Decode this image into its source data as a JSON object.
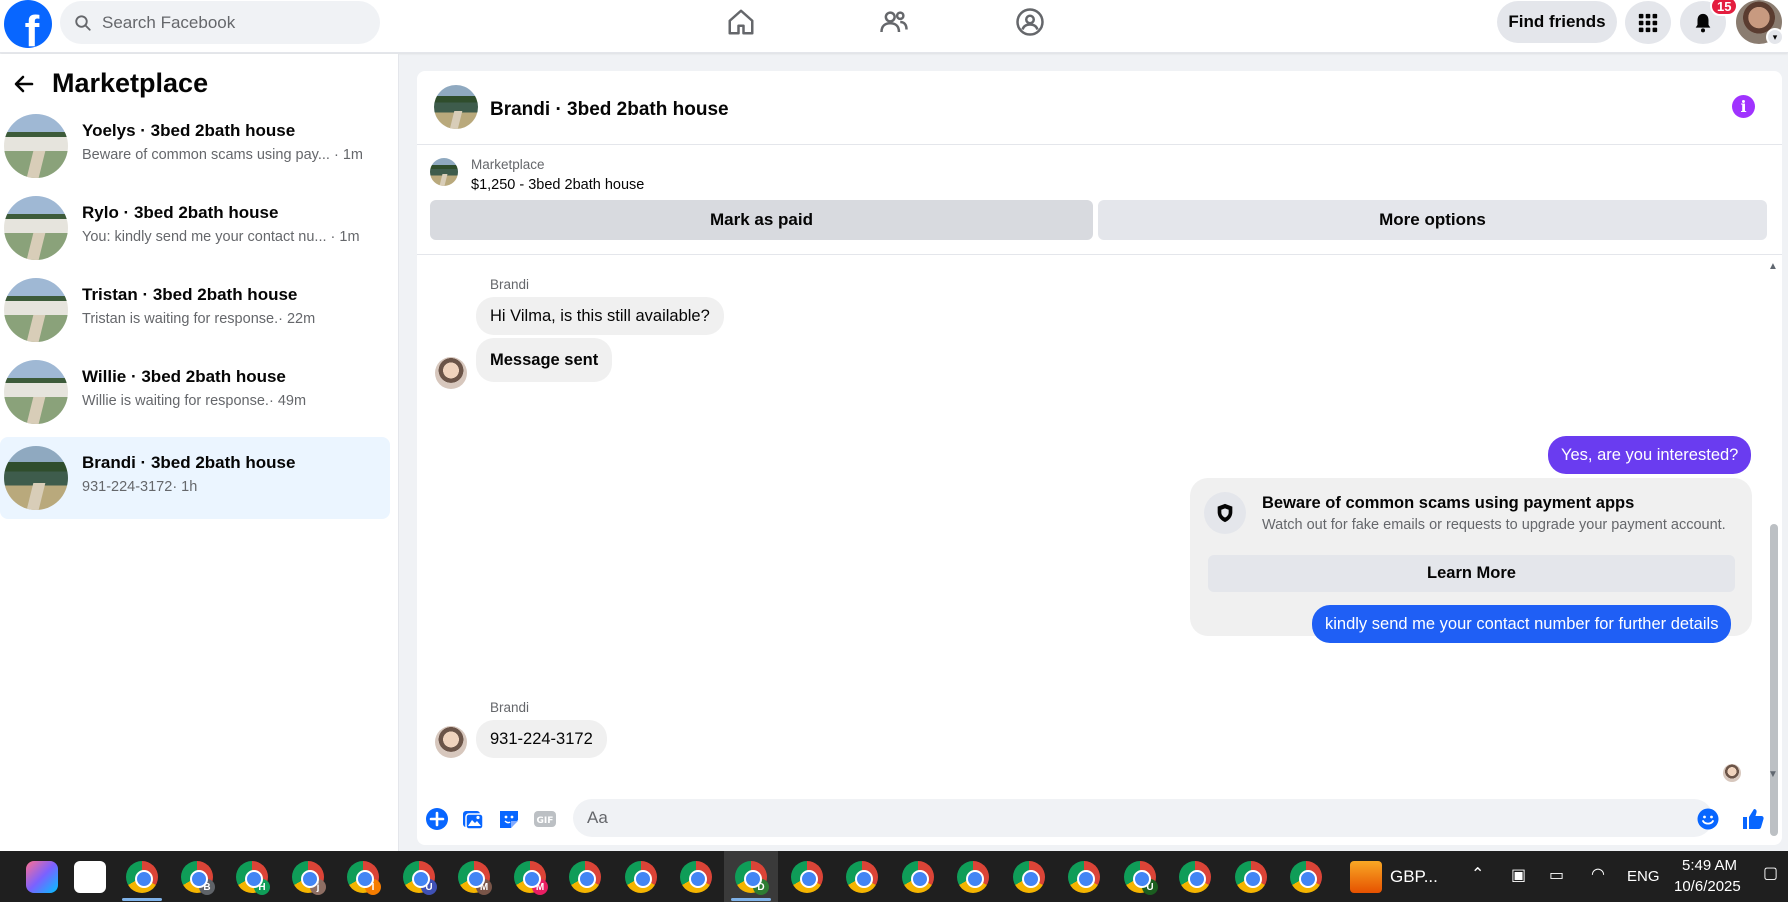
{
  "topbar": {
    "logo": "f",
    "search_placeholder": "Search Facebook",
    "find_friends": "Find friends",
    "notification_count": "15",
    "icons": [
      "home-icon",
      "friends-icon",
      "groups-icon",
      "menu-grid-icon",
      "bell-icon"
    ]
  },
  "sidebar": {
    "title": "Marketplace",
    "conversations": [
      {
        "name": "Yoelys · 3bed 2bath house",
        "preview": "Beware of common scams using pay...",
        "time": "· 1m"
      },
      {
        "name": "Rylo · 3bed 2bath house",
        "preview": "You: kindly send me your contact nu...",
        "time": "· 1m"
      },
      {
        "name": "Tristan · 3bed 2bath house",
        "preview": "Tristan is waiting for response.",
        "time": "· 22m"
      },
      {
        "name": "Willie · 3bed 2bath house",
        "preview": "Willie is waiting for response.",
        "time": "· 49m"
      },
      {
        "name": "Brandi · 3bed 2bath house",
        "preview": "931-224-3172",
        "time": "· 1h"
      }
    ]
  },
  "chat": {
    "title": "Brandi · 3bed 2bath house",
    "listing_label": "Marketplace",
    "listing_price": "$1,250 - 3bed 2bath house",
    "mark_paid": "Mark as paid",
    "more_options": "More options",
    "messages": {
      "sender1": "Brandi",
      "in1": "Hi Vilma, is this still available?",
      "in2": "Message sent",
      "out1": "Yes, are you interested?",
      "scam_title": "Beware of common scams using payment apps",
      "scam_text": "Watch out for fake emails or requests to upgrade your payment account.",
      "learn_more": "Learn More",
      "out2": "kindly send me your contact number for further details",
      "sender2": "Brandi",
      "in3": "931-224-3172"
    },
    "composer_placeholder": "Aa"
  },
  "taskbar": {
    "pinned_label": "GBP...",
    "lang": "ENG",
    "time": "5:49 AM",
    "date": "10/6/2025",
    "profile_letters": [
      "",
      "B",
      "H",
      "j",
      "I",
      "U",
      "M",
      "M",
      "",
      "",
      "",
      "D",
      "",
      "",
      "",
      "",
      "",
      "",
      "U",
      "",
      "",
      ""
    ]
  },
  "colors": {
    "accent": "#0866ff",
    "outgoing": "#6a3cf0",
    "outgoing_blue": "#1f5ff5",
    "active_conv": "#ebf5ff"
  }
}
